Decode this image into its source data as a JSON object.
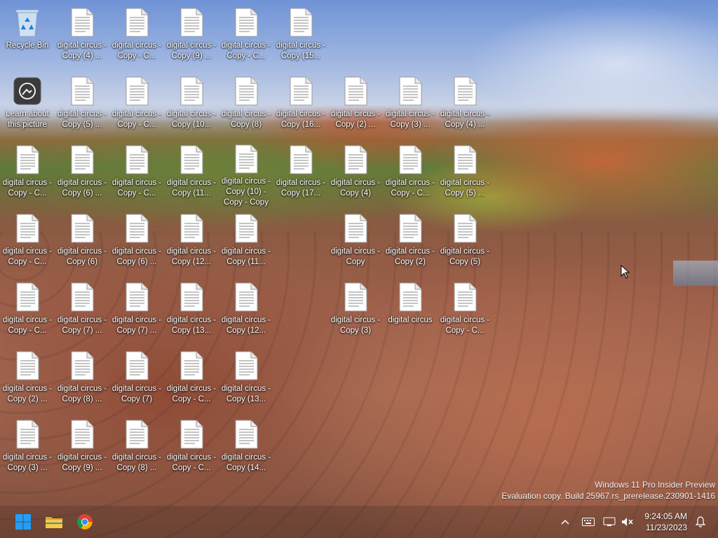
{
  "desktop": {
    "icons": [
      {
        "label": "Recycle Bin",
        "kind": "recycle-bin"
      },
      {
        "label": "digital circus - Copy (4) ...",
        "kind": "file"
      },
      {
        "label": "digital circus - Copy - C...",
        "kind": "file"
      },
      {
        "label": "digital circus - Copy (9) ...",
        "kind": "file"
      },
      {
        "label": "digital circus - Copy - C...",
        "kind": "file"
      },
      {
        "label": "digital circus - Copy (15...",
        "kind": "file"
      },
      {
        "label": "Learn about this picture",
        "kind": "learn"
      },
      {
        "label": "digital circus - Copy (5) ...",
        "kind": "file"
      },
      {
        "label": "digital circus - Copy - C...",
        "kind": "file"
      },
      {
        "label": "digital circus - Copy (10...",
        "kind": "file"
      },
      {
        "label": "digital circus - Copy (8)",
        "kind": "file"
      },
      {
        "label": "digital circus - Copy (16...",
        "kind": "file"
      },
      {
        "label": "digital circus - Copy (2) ...",
        "kind": "file"
      },
      {
        "label": "digital circus - Copy (3) ...",
        "kind": "file"
      },
      {
        "label": "digital circus - Copy (4) ...",
        "kind": "file"
      },
      {
        "label": "digital circus - Copy - C...",
        "kind": "file"
      },
      {
        "label": "digital circus - Copy (6) ...",
        "kind": "file"
      },
      {
        "label": "digital circus - Copy - C...",
        "kind": "file"
      },
      {
        "label": "digital circus - Copy (11...",
        "kind": "file"
      },
      {
        "label": "digital circus - Copy (10) - Copy - Copy",
        "kind": "file"
      },
      {
        "label": "digital circus - Copy (17...",
        "kind": "file"
      },
      {
        "label": "digital circus - Copy (4)",
        "kind": "file"
      },
      {
        "label": "digital circus - Copy - C...",
        "kind": "file"
      },
      {
        "label": "digital circus - Copy (5) ...",
        "kind": "file"
      },
      {
        "label": "digital circus - Copy - C...",
        "kind": "file"
      },
      {
        "label": "digital circus - Copy (6)",
        "kind": "file"
      },
      {
        "label": "digital circus - Copy (6) ...",
        "kind": "file"
      },
      {
        "label": "digital circus - Copy (12...",
        "kind": "file"
      },
      {
        "label": "digital circus - Copy (11...",
        "kind": "file"
      },
      {
        "label": "digital circus - Copy",
        "kind": "file"
      },
      {
        "label": "digital circus - Copy (2)",
        "kind": "file"
      },
      {
        "label": "digital circus - Copy (5)",
        "kind": "file"
      },
      {
        "label": "digital circus - Copy - C...",
        "kind": "file"
      },
      {
        "label": "digital circus - Copy (7) ...",
        "kind": "file"
      },
      {
        "label": "digital circus - Copy (7) ...",
        "kind": "file"
      },
      {
        "label": "digital circus - Copy (13...",
        "kind": "file"
      },
      {
        "label": "digital circus - Copy (12...",
        "kind": "file"
      },
      {
        "label": "digital circus - Copy (3)",
        "kind": "file"
      },
      {
        "label": "digital circus",
        "kind": "file"
      },
      {
        "label": "digital circus - Copy - C...",
        "kind": "file"
      },
      {
        "label": "digital circus - Copy (2) ...",
        "kind": "file"
      },
      {
        "label": "digital circus - Copy (8) ...",
        "kind": "file"
      },
      {
        "label": "digital circus - Copy (7)",
        "kind": "file"
      },
      {
        "label": "digital circus - Copy - C...",
        "kind": "file"
      },
      {
        "label": "digital circus - Copy (13...",
        "kind": "file"
      },
      {
        "label": "digital circus - Copy (3) ...",
        "kind": "file"
      },
      {
        "label": "digital circus - Copy (9) ...",
        "kind": "file"
      },
      {
        "label": "digital circus - Copy (8) ...",
        "kind": "file"
      },
      {
        "label": "digital circus - Copy - C...",
        "kind": "file"
      },
      {
        "label": "digital circus - Copy (14...",
        "kind": "file"
      }
    ]
  },
  "watermark": {
    "line1": "Windows 11 Pro Insider Preview",
    "line2": "Evaluation copy. Build 25967.rs_prerelease.230901-1416"
  },
  "taskbar": {
    "apps": [
      {
        "name": "start-button",
        "icon": "windows-logo-icon"
      },
      {
        "name": "file-explorer-button",
        "icon": "folder-icon"
      },
      {
        "name": "chrome-button",
        "icon": "chrome-icon"
      }
    ],
    "tray": {
      "icons": [
        "chevron-up-icon",
        "keyboard-icon",
        "network-icon",
        "volume-muted-icon"
      ],
      "time": "9:24:05 AM",
      "date": "11/23/2023"
    }
  },
  "colors": {
    "label_text": "#ffffff",
    "accent_start": "#1e90ff",
    "folder": "#f2c14e"
  }
}
